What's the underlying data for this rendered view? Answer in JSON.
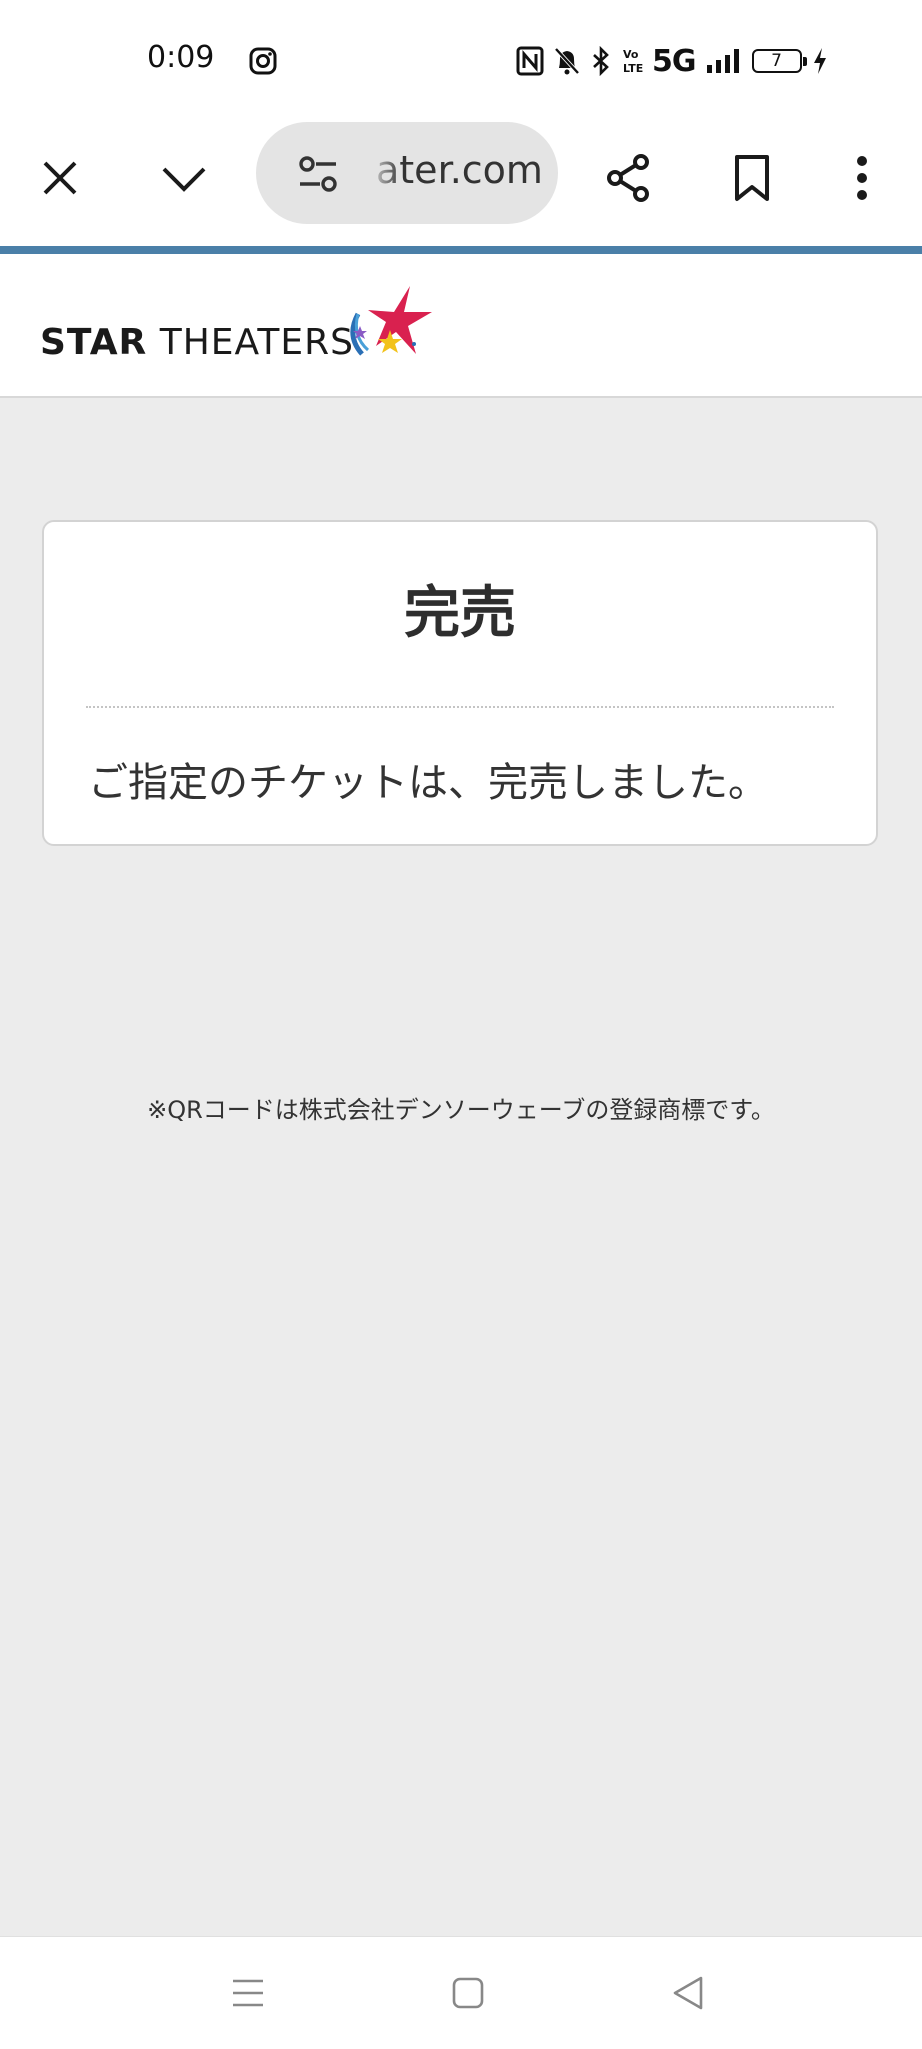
{
  "status_bar": {
    "time": "0:09",
    "network": "5G",
    "battery_level": "7"
  },
  "browser": {
    "url_text": "ater.com"
  },
  "site": {
    "logo_bold": "STAR",
    "logo_light": " THEATERS",
    "brand_colors": {
      "star_red": "#d9214f",
      "accent_blue": "#2a6fb5",
      "accent_yellow": "#f2c21b",
      "accent_purple": "#8a5bc5"
    }
  },
  "card": {
    "title": "完売",
    "message": "ご指定のチケットは、完売しました。"
  },
  "footnote": "※QRコードは株式会社デンソーウェーブの登録商標です。",
  "icons": {
    "close": "close-icon",
    "collapse": "chevron-down-icon",
    "site_settings": "tune-icon",
    "share": "share-icon",
    "bookmark": "bookmark-icon",
    "menu": "more-vert-icon"
  }
}
